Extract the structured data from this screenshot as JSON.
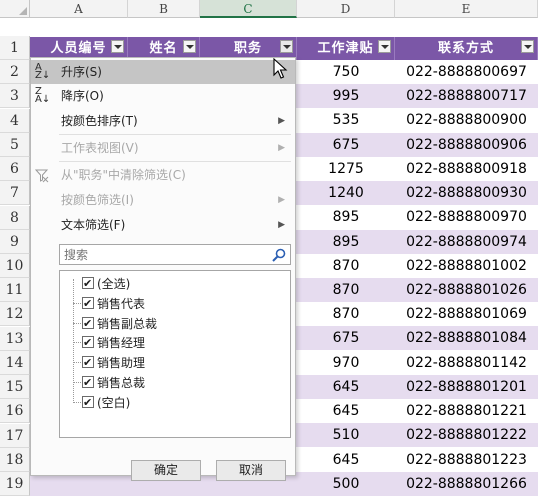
{
  "columns": [
    "A",
    "B",
    "C",
    "D",
    "E"
  ],
  "row_numbers": [
    "1",
    "2",
    "3",
    "4",
    "5",
    "6",
    "7",
    "8",
    "9",
    "10",
    "11",
    "12",
    "13",
    "14",
    "15",
    "16",
    "17",
    "18",
    "19"
  ],
  "table_headers": [
    "人员编号",
    "姓名",
    "职务",
    "工作津贴",
    "联系方式"
  ],
  "rows": [
    {
      "allowance": "750",
      "contact": "022-8888800697"
    },
    {
      "allowance": "995",
      "contact": "022-8888800717"
    },
    {
      "allowance": "535",
      "contact": "022-8888800900"
    },
    {
      "allowance": "675",
      "contact": "022-8888800906"
    },
    {
      "allowance": "1275",
      "contact": "022-8888800918"
    },
    {
      "allowance": "1240",
      "contact": "022-8888800930"
    },
    {
      "allowance": "895",
      "contact": "022-8888800970"
    },
    {
      "allowance": "895",
      "contact": "022-8888800974"
    },
    {
      "allowance": "870",
      "contact": "022-8888801002"
    },
    {
      "allowance": "870",
      "contact": "022-8888801026"
    },
    {
      "allowance": "870",
      "contact": "022-8888801069"
    },
    {
      "allowance": "675",
      "contact": "022-8888801084"
    },
    {
      "allowance": "970",
      "contact": "022-8888801142"
    },
    {
      "allowance": "645",
      "contact": "022-8888801201"
    },
    {
      "allowance": "645",
      "contact": "022-8888801221"
    },
    {
      "allowance": "510",
      "contact": "022-8888801222"
    },
    {
      "allowance": "645",
      "contact": "022-8888801223"
    },
    {
      "allowance": "500",
      "contact": "022-8888801266"
    }
  ],
  "menu": {
    "sort_asc": "升序(S)",
    "sort_desc": "降序(O)",
    "sort_by_color": "按颜色排序(T)",
    "sheet_view": "工作表视图(V)",
    "clear_filter": "从\"职务\"中清除筛选(C)",
    "filter_by_color": "按颜色筛选(I)",
    "text_filter": "文本筛选(F)",
    "search_placeholder": "搜索",
    "list_items": [
      "(全选)",
      "销售代表",
      "销售副总裁",
      "销售经理",
      "销售助理",
      "销售总裁",
      "(空白)"
    ],
    "ok": "确定",
    "cancel": "取消"
  },
  "colors": {
    "header_purple": "#7b57a7",
    "band_lavender": "#e6dcef",
    "excel_green": "#217346"
  },
  "icons": {
    "sort_asc": "sort-ascending-icon",
    "sort_desc": "sort-descending-icon",
    "clear_filter": "clear-filter-icon",
    "search": "search-icon",
    "submenu": "chevron-right-icon",
    "filter_dropdown": "filter-dropdown-icon",
    "cursor": "mouse-pointer-icon"
  }
}
